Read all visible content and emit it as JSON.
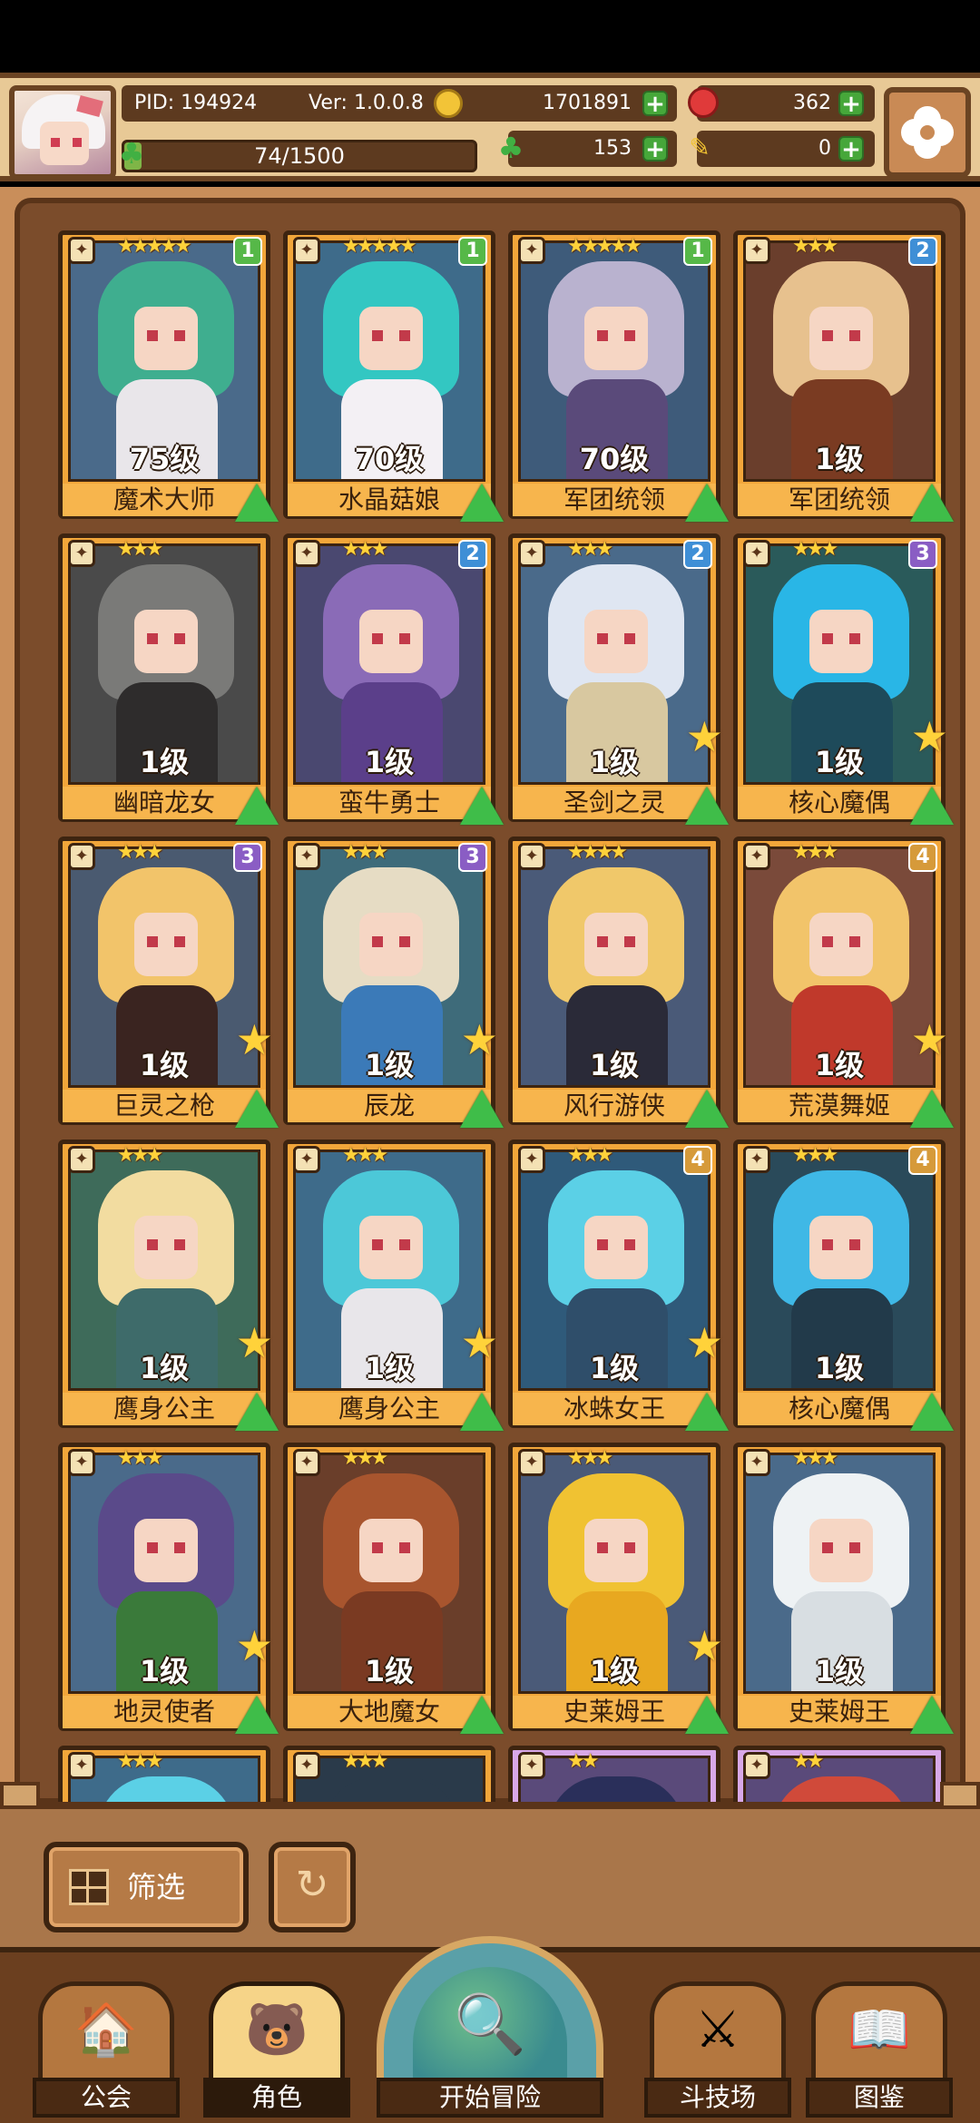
{
  "header": {
    "pid": "PID: 194924",
    "version": "Ver: 1.0.0.8",
    "gold": "1701891",
    "gems": "362",
    "energy_text": "74/1500",
    "energy_ratio": 0.049,
    "clover": "153",
    "horn": "0"
  },
  "cards": [
    {
      "name": "魔术大师",
      "level": "75级",
      "stars": "★★★★★",
      "awaken": "1",
      "awaken_color": "#56b848",
      "hair": "#3fae8f",
      "body": "#e9e6ea",
      "bg": "#4a6a8a",
      "frame": "orange",
      "star_badge": false
    },
    {
      "name": "水晶菇娘",
      "level": "70级",
      "stars": "★★★★★",
      "awaken": "1",
      "awaken_color": "#56b848",
      "hair": "#33c7c2",
      "body": "#f3f0f4",
      "bg": "#3e6b8a",
      "frame": "orange",
      "star_badge": false
    },
    {
      "name": "军团统领",
      "level": "70级",
      "stars": "★★★★★",
      "awaken": "1",
      "awaken_color": "#56b848",
      "hair": "#b9b2cf",
      "body": "#5a4a7a",
      "bg": "#3e5b7a",
      "frame": "orange",
      "star_badge": false
    },
    {
      "name": "军团统领",
      "level": "1级",
      "stars": "★★★",
      "awaken": "2",
      "awaken_color": "#3f8fd6",
      "hair": "#e7c18e",
      "body": "#7a3b22",
      "bg": "#6a3e2c",
      "frame": "orange",
      "star_badge": false
    },
    {
      "name": "幽暗龙女",
      "level": "1级",
      "stars": "★★★",
      "awaken": "",
      "awaken_color": "",
      "hair": "#7a7a78",
      "body": "#2e2c2c",
      "bg": "#4a4a4a",
      "frame": "orange",
      "star_badge": false
    },
    {
      "name": "蛮牛勇士",
      "level": "1级",
      "stars": "★★★",
      "awaken": "2",
      "awaken_color": "#3f8fd6",
      "hair": "#8a6bb7",
      "body": "#5b3f8a",
      "bg": "#4a4870",
      "frame": "orange",
      "star_badge": false
    },
    {
      "name": "圣剑之灵",
      "level": "1级",
      "stars": "★★★",
      "awaken": "2",
      "awaken_color": "#3f8fd6",
      "hair": "#dfe6f2",
      "body": "#d8c8a0",
      "bg": "#4a6a8a",
      "frame": "orange",
      "star_badge": true
    },
    {
      "name": "核心魔偶",
      "level": "1级",
      "stars": "★★★",
      "awaken": "3",
      "awaken_color": "#8a5dc4",
      "hair": "#29b6e6",
      "body": "#1e4a5a",
      "bg": "#2a5a5a",
      "frame": "orange",
      "star_badge": true
    },
    {
      "name": "巨灵之枪",
      "level": "1级",
      "stars": "★★★",
      "awaken": "3",
      "awaken_color": "#8a5dc4",
      "hair": "#f2c46a",
      "body": "#3a2420",
      "bg": "#4a5a70",
      "frame": "orange",
      "star_badge": true
    },
    {
      "name": "辰龙",
      "level": "1级",
      "stars": "★★★",
      "awaken": "3",
      "awaken_color": "#8a5dc4",
      "hair": "#e6dcc4",
      "body": "#3b7ab8",
      "bg": "#3e6b7a",
      "frame": "orange",
      "star_badge": true
    },
    {
      "name": "风行游侠",
      "level": "1级",
      "stars": "★★★★",
      "awaken": "",
      "awaken_color": "",
      "hair": "#f0c86a",
      "body": "#2a2a38",
      "bg": "#4a5a78",
      "frame": "orange",
      "star_badge": false
    },
    {
      "name": "荒漠舞姬",
      "level": "1级",
      "stars": "★★★",
      "awaken": "4",
      "awaken_color": "#d69a3a",
      "hair": "#f2c46a",
      "body": "#c0392b",
      "bg": "#7a4a3a",
      "frame": "orange",
      "star_badge": true
    },
    {
      "name": "鹰身公主",
      "level": "1级",
      "stars": "★★★",
      "awaken": "",
      "awaken_color": "",
      "hair": "#f2dca0",
      "body": "#3e6b6a",
      "bg": "#3e6b5a",
      "frame": "orange",
      "star_badge": true
    },
    {
      "name": "鹰身公主",
      "level": "1级",
      "stars": "★★★",
      "awaken": "",
      "awaken_color": "",
      "hair": "#4cc8d8",
      "body": "#e8e6ea",
      "bg": "#3e6b8a",
      "frame": "orange",
      "star_badge": true
    },
    {
      "name": "冰蛛女王",
      "level": "1级",
      "stars": "★★★",
      "awaken": "4",
      "awaken_color": "#d69a3a",
      "hair": "#5bd0e6",
      "body": "#2f4e6a",
      "bg": "#2f5a7a",
      "frame": "orange",
      "star_badge": true
    },
    {
      "name": "核心魔偶",
      "level": "1级",
      "stars": "★★★",
      "awaken": "4",
      "awaken_color": "#d69a3a",
      "hair": "#3fb8e6",
      "body": "#223a4a",
      "bg": "#2a4a5a",
      "frame": "orange",
      "star_badge": false
    },
    {
      "name": "地灵使者",
      "level": "1级",
      "stars": "★★★",
      "awaken": "",
      "awaken_color": "",
      "hair": "#5a4a8a",
      "body": "#3a7a3a",
      "bg": "#4a6a8a",
      "frame": "orange",
      "star_badge": true
    },
    {
      "name": "大地魔女",
      "level": "1级",
      "stars": "★★★",
      "awaken": "",
      "awaken_color": "",
      "hair": "#a8552e",
      "body": "#7a3a22",
      "bg": "#6a3e2a",
      "frame": "orange",
      "star_badge": false
    },
    {
      "name": "史莱姆王",
      "level": "1级",
      "stars": "★★★",
      "awaken": "",
      "awaken_color": "",
      "hair": "#f0c232",
      "body": "#e8a820",
      "bg": "#4a5a78",
      "frame": "orange",
      "star_badge": true
    },
    {
      "name": "史莱姆王",
      "level": "1级",
      "stars": "★★★",
      "awaken": "",
      "awaken_color": "",
      "hair": "#eef2f4",
      "body": "#d8dee2",
      "bg": "#4a6a8a",
      "frame": "orange",
      "star_badge": false
    },
    {
      "name": "",
      "level": "",
      "stars": "★★★",
      "awaken": "",
      "awaken_color": "",
      "hair": "#5bd0e6",
      "body": "#2f4e6a",
      "bg": "#3e6b8a",
      "frame": "orange",
      "star_badge": false
    },
    {
      "name": "",
      "level": "",
      "stars": "★★★",
      "awaken": "",
      "awaken_color": "",
      "hair": "#2a3a4a",
      "body": "#1e2a38",
      "bg": "#2a3a4a",
      "frame": "orange",
      "star_badge": false
    },
    {
      "name": "",
      "level": "",
      "stars": "★★",
      "awaken": "",
      "awaken_color": "",
      "hair": "#2a2f5a",
      "body": "#1e2240",
      "bg": "#5a4a7a",
      "frame": "purple",
      "star_badge": false
    },
    {
      "name": "",
      "level": "",
      "stars": "★★",
      "awaken": "",
      "awaken_color": "",
      "hair": "#d04a3a",
      "body": "#2a2a38",
      "bg": "#5a4a7a",
      "frame": "purple",
      "star_badge": false
    }
  ],
  "filter": {
    "label": "筛选"
  },
  "nav": [
    {
      "label": "公会",
      "glyph": "🏠"
    },
    {
      "label": "角色",
      "glyph": "🐻"
    },
    {
      "label": "开始冒险",
      "glyph": "🔍"
    },
    {
      "label": "斗技场",
      "glyph": "⚔"
    },
    {
      "label": "图鉴",
      "glyph": "📖"
    }
  ]
}
